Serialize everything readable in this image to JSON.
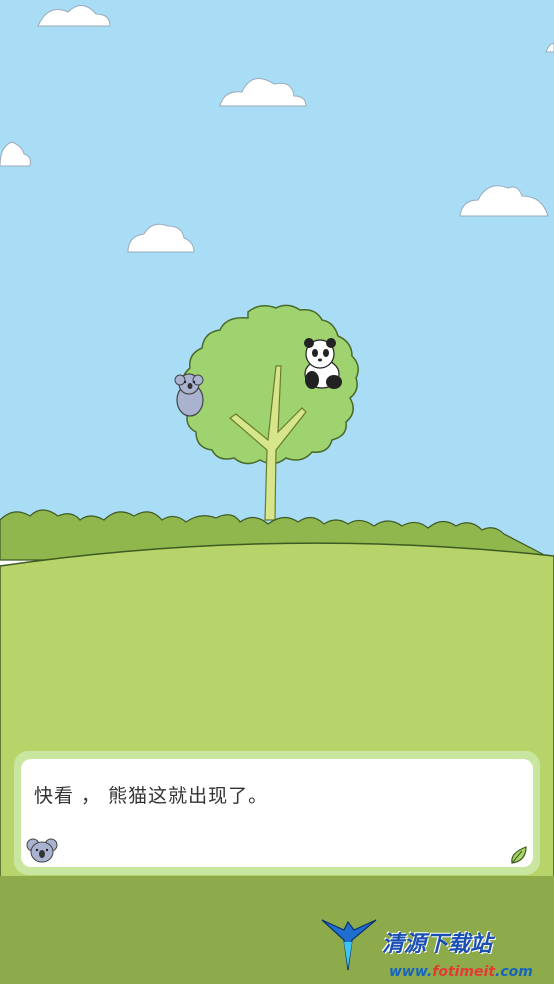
{
  "dialog": {
    "text": "快看 ， 熊猫这就出现了。"
  },
  "watermark": {
    "title": "清源下载站",
    "url_prefix": "www.",
    "url_highlight": "fotimeit",
    "url_suffix": ".com"
  },
  "colors": {
    "sky": "#a9ddf6",
    "grass": "#b6d46a",
    "bush": "#8fb74e",
    "tree_canopy": "#9fd36f",
    "dialog_frame": "#c9e6a0"
  },
  "icons": {
    "speaker": "koala-face-icon",
    "next": "leaf-icon"
  }
}
